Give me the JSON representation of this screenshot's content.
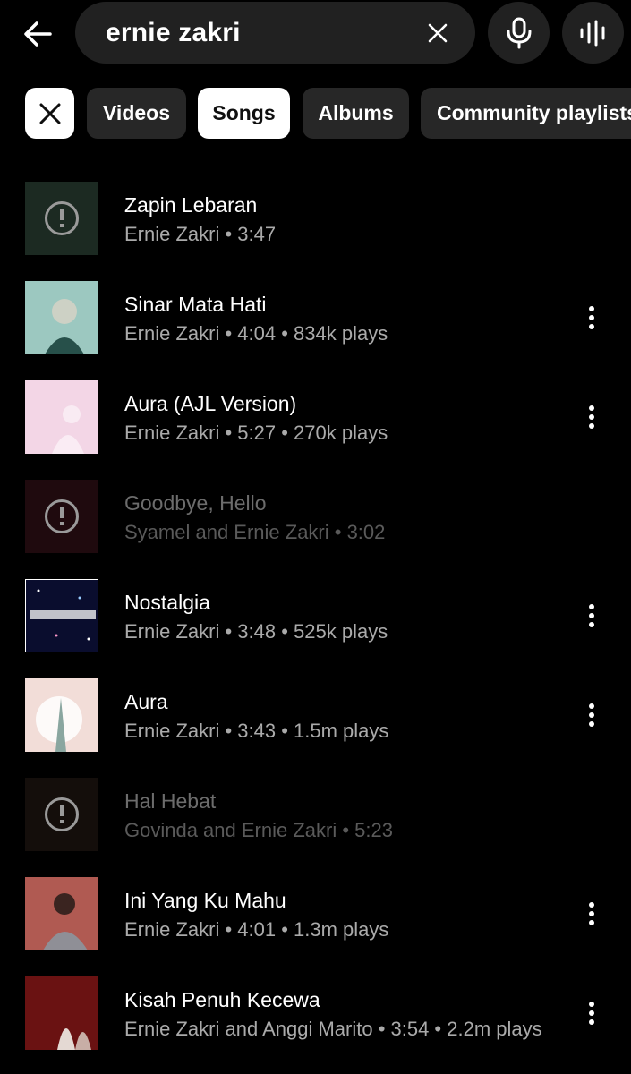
{
  "search": {
    "query": "ernie zakri"
  },
  "filters": {
    "videos": "Videos",
    "songs": "Songs",
    "albums": "Albums",
    "community": "Community playlists"
  },
  "songs": [
    {
      "title": "Zapin Lebaran",
      "subtitle": "Ernie Zakri • 3:47",
      "available": false,
      "art": [
        "#1c2a22",
        "#0e1410"
      ]
    },
    {
      "title": "Sinar Mata Hati",
      "subtitle": "Ernie Zakri • 4:04 • 834k plays",
      "available": true,
      "art": [
        "#9cc8c0",
        "#2f5a52"
      ]
    },
    {
      "title": "Aura (AJL Version)",
      "subtitle": "Ernie Zakri • 5:27 • 270k plays",
      "available": true,
      "art": [
        "#f3d6e6",
        "#e3aecd"
      ]
    },
    {
      "title": "Goodbye, Hello",
      "subtitle": "Syamel and Ernie Zakri • 3:02",
      "available": false,
      "art": [
        "#5a1e2a",
        "#1a0c10"
      ]
    },
    {
      "title": "Nostalgia",
      "subtitle": "Ernie Zakri • 3:48 • 525k plays",
      "available": true,
      "art": [
        "#0a0d2e",
        "#3b2a7a"
      ]
    },
    {
      "title": "Aura",
      "subtitle": "Ernie Zakri • 3:43 • 1.5m plays",
      "available": true,
      "art": [
        "#f2ddd8",
        "#d8b4b0"
      ]
    },
    {
      "title": "Hal Hebat",
      "subtitle": "Govinda and Ernie Zakri • 5:23",
      "available": false,
      "art": [
        "#3a2a22",
        "#120c0a"
      ]
    },
    {
      "title": "Ini Yang Ku Mahu",
      "subtitle": "Ernie Zakri • 4:01 • 1.3m plays",
      "available": true,
      "art": [
        "#b05a52",
        "#6a3a3a"
      ]
    },
    {
      "title": "Kisah Penuh Kecewa",
      "subtitle": "Ernie Zakri and Anggi Marito • 3:54 • 2.2m plays",
      "available": true,
      "art": [
        "#6a1212",
        "#2a0606"
      ]
    }
  ]
}
